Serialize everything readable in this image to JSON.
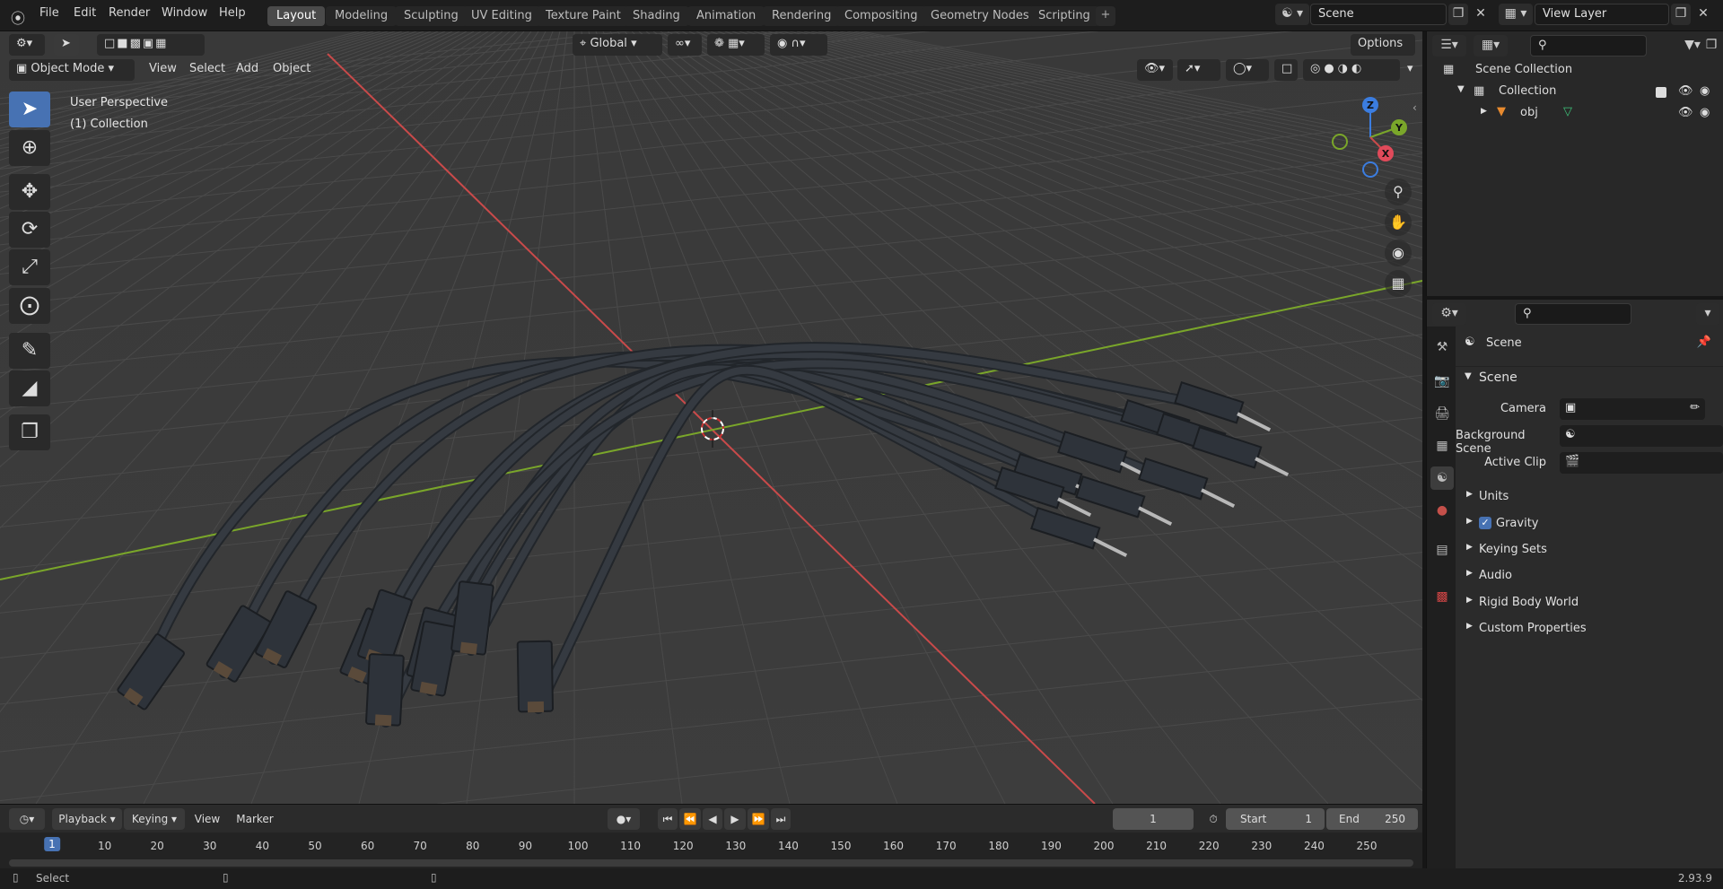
{
  "topbar": {
    "menus": [
      "File",
      "Edit",
      "Render",
      "Window",
      "Help"
    ],
    "workspaces": [
      "Layout",
      "Modeling",
      "Sculpting",
      "UV Editing",
      "Texture Paint",
      "Shading",
      "Animation",
      "Rendering",
      "Compositing",
      "Geometry Nodes",
      "Scripting"
    ],
    "add_workspace": "+",
    "scene_name": "Scene",
    "view_layer": "View Layer"
  },
  "viewport": {
    "mode": "Object Mode",
    "menus": [
      "View",
      "Select",
      "Add",
      "Object"
    ],
    "transform_orientation": "Global",
    "options_label": "Options",
    "perspective_label": "User Perspective",
    "collection_label": "(1) Collection",
    "gizmo": {
      "x": "X",
      "y": "Y",
      "z": "Z"
    }
  },
  "timeline": {
    "menus": [
      "Playback",
      "Keying",
      "View",
      "Marker"
    ],
    "current_frame": "1",
    "start_label": "Start",
    "start_value": "1",
    "end_label": "End",
    "end_value": "250",
    "ticks": [
      "1",
      "10",
      "20",
      "30",
      "40",
      "50",
      "60",
      "70",
      "80",
      "90",
      "100",
      "110",
      "120",
      "130",
      "140",
      "150",
      "160",
      "170",
      "180",
      "190",
      "200",
      "210",
      "220",
      "230",
      "240",
      "250"
    ]
  },
  "statusbar": {
    "hint": "Select",
    "version": "2.93.9"
  },
  "outliner": {
    "root": "Scene Collection",
    "collection": "Collection",
    "object": "obj"
  },
  "properties": {
    "context": "Scene",
    "panel_title": "Scene",
    "camera_label": "Camera",
    "background_scene_label": "Background Scene",
    "active_clip_label": "Active Clip",
    "sections": [
      "Units",
      "Gravity",
      "Keying Sets",
      "Audio",
      "Rigid Body World",
      "Custom Properties"
    ]
  },
  "colors": {
    "accent": "#4772b3",
    "x_axis": "#c94a4a",
    "y_axis": "#7aa62a",
    "z_axis": "#3b7de0",
    "cable": "#353a41"
  }
}
